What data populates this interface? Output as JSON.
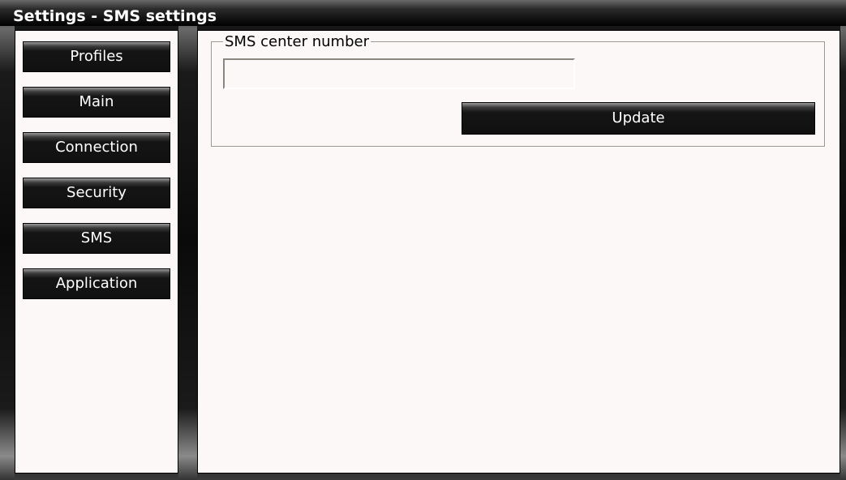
{
  "window": {
    "title": "Settings - SMS settings"
  },
  "sidebar": {
    "items": [
      {
        "label": "Profiles"
      },
      {
        "label": "Main"
      },
      {
        "label": "Connection"
      },
      {
        "label": "Security"
      },
      {
        "label": "SMS"
      },
      {
        "label": "Application"
      }
    ]
  },
  "sms_settings": {
    "group_label": "SMS center number",
    "center_number_value": "",
    "update_label": "Update"
  },
  "colors": {
    "panel_background": "#fdf8f8",
    "button_background": "#101010",
    "button_text": "#ffffff"
  }
}
